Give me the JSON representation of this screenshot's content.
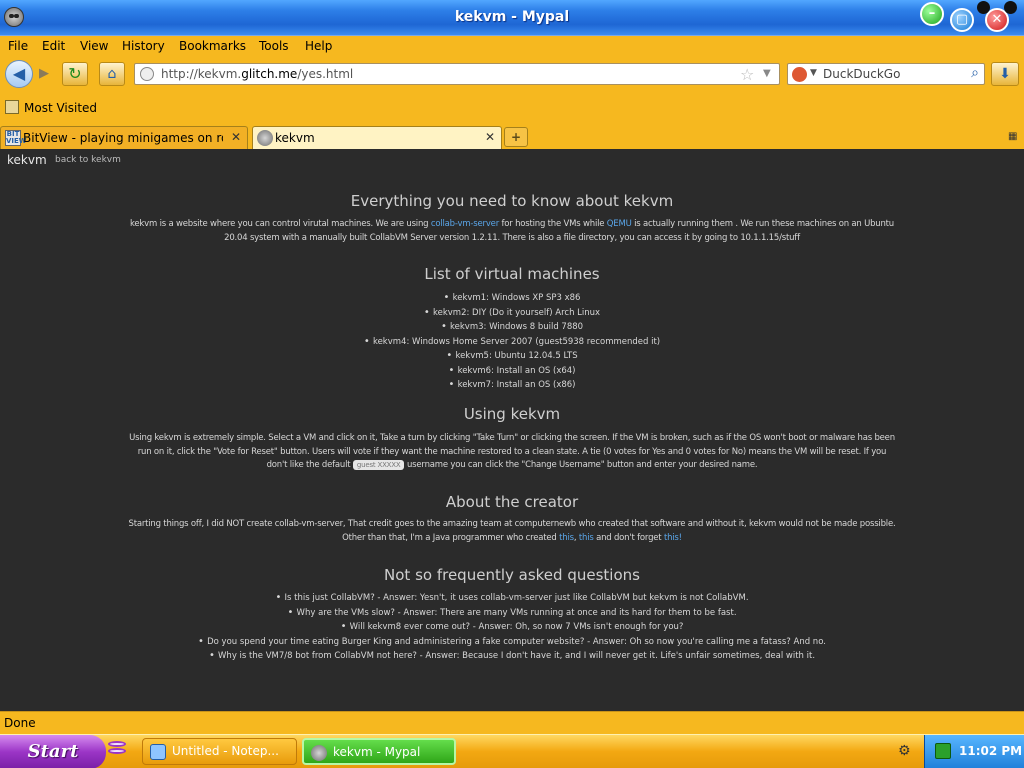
{
  "window": {
    "title": "kekvm - Mypal",
    "buttons": {
      "minimize": "–",
      "maximize": "▢",
      "close": "✕"
    }
  },
  "menubar": [
    "File",
    "Edit",
    "View",
    "History",
    "Bookmarks",
    "Tools",
    "Help"
  ],
  "navbar": {
    "back_icon": "left-arrow-icon",
    "forward_icon": "right-arrow-icon",
    "reload_icon": "reload-icon",
    "home_icon": "home-icon",
    "url_prefix": "http://kekvm.",
    "url_host": "glitch.me",
    "url_path": "/yes.html",
    "search_placeholder": "DuckDuckGo"
  },
  "bookmarks": {
    "label": "Most Visited"
  },
  "tabs": [
    {
      "label": "BitView - playing minigames on ro...",
      "favicon": "BIT VIEW",
      "active": false
    },
    {
      "label": "kekvm",
      "active": true
    }
  ],
  "page": {
    "brand": "kekvm",
    "back_link": "back to kekvm",
    "sections": {
      "about": {
        "heading": "Everything you need to know about kekvm",
        "text_1": "kekvm is a website where you can control virutal machines. We are using ",
        "link_collab": "collab-vm-server",
        "text_2": " for hosting the VMs while ",
        "link_qemu": "QEMU",
        "text_3": " is actually running them . We run these machines on an Ubuntu 20.04 system with a manually built CollabVM Server version 1.2.11. There is also a file directory, you can access it by going to 10.1.1.15/stuff"
      },
      "vms": {
        "heading": "List of virtual machines",
        "items": [
          "kekvm1: Windows XP SP3 x86",
          "kekvm2: DIY (Do it yourself) Arch Linux",
          "kekvm3: Windows 8 build 7880",
          "kekvm4: Windows Home Server 2007 (guest5938 recommended it)",
          "kekvm5: Ubuntu 12.04.5 LTS",
          "kekvm6: Install an OS (x64)",
          "kekvm7: Install an OS (x86)"
        ]
      },
      "using": {
        "heading": "Using kekvm",
        "text_1": "Using kekvm is extremely simple. Select a VM and click on it, Take a turn by clicking \"Take Turn\" or clicking the screen. If the VM is broken, such as if the OS won't boot or malware has been run on it, click the \"Vote for Reset\" button. Users will vote if they want the machine restored to a clean state. A tie (0 votes for Yes and 0 votes for No) means the VM will be reset. If you don't like the default ",
        "chip": "guest XXXXX",
        "text_2": " username you can click the \"Change Username\" button and enter your desired name."
      },
      "creator": {
        "heading": "About the creator",
        "text_1": "Starting things off, I did NOT create collab-vm-server, That credit goes to the amazing team at computernewb who created that software and without it, kekvm would not be made possible. Other than that, I'm a Java programmer who created ",
        "link_1": "this",
        "sep": ", ",
        "link_2": "this",
        "text_2": " and don't forget ",
        "link_3": "this!"
      },
      "faq": {
        "heading": "Not so frequently asked questions",
        "items": [
          "Is this just CollabVM? - Answer: Yesn't, it uses collab-vm-server just like CollabVM but kekvm is not CollabVM.",
          "Why are the VMs slow? - Answer: There are many VMs running at once and its hard for them to be fast.",
          "Will kekvm8 ever come out? - Answer: Oh, so now 7 VMs isn't enough for you?",
          "Do you spend your time eating Burger King and administering a fake computer website? - Answer: Oh so now you're calling me a fatass? And no.",
          "Why is the VM7/8 bot from CollabVM not here? - Answer: Because I don't have it, and I will never get it. Life's unfair sometimes, deal with it."
        ]
      }
    }
  },
  "statusbar": {
    "text": "Done"
  },
  "taskbar": {
    "start_label": "Start",
    "tasks": [
      {
        "label": "Untitled - Notep..."
      },
      {
        "label": "kekvm - Mypal"
      }
    ],
    "clock": "11:02 PM"
  },
  "colors": {
    "chrome": "#f6b81f",
    "titlebar": "#1e66d4",
    "page_bg": "#2b2b2b",
    "link": "#5aa5e8",
    "start": "#9b35c6",
    "active_task": "#2fa618"
  }
}
